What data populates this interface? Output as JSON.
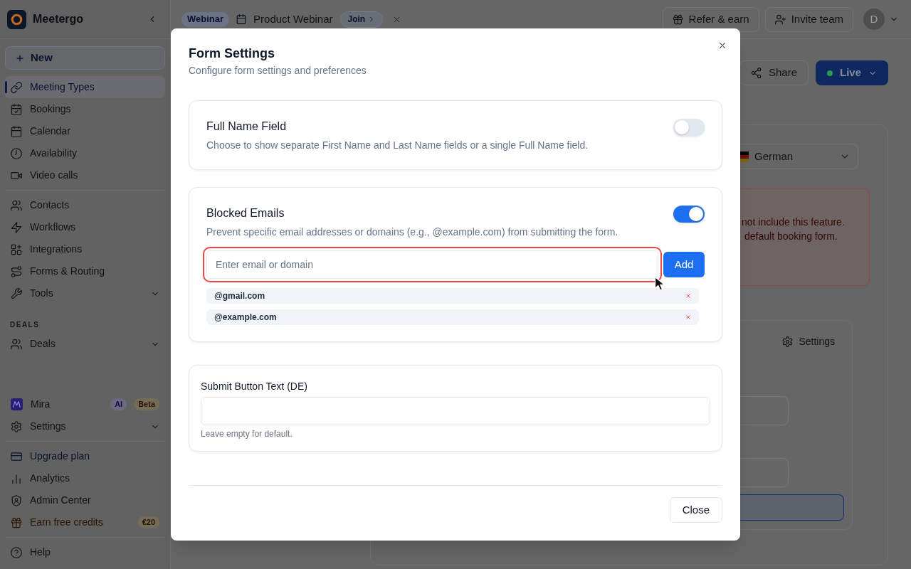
{
  "sidebar": {
    "brand": "Meetergo",
    "new_button": "New",
    "main_sections": [
      {
        "items": [
          {
            "label": "Meeting Types",
            "kind": "link",
            "selected": true
          },
          {
            "label": "Bookings",
            "kind": "link",
            "selected": false
          },
          {
            "label": "Calendar",
            "kind": "link",
            "selected": false
          },
          {
            "label": "Availability",
            "kind": "link",
            "selected": false
          },
          {
            "label": "Video calls",
            "kind": "link",
            "selected": false
          }
        ]
      },
      {
        "items": [
          {
            "label": "Contacts",
            "kind": "link",
            "selected": false
          },
          {
            "label": "Workflows",
            "kind": "link",
            "selected": false
          },
          {
            "label": "Integrations",
            "kind": "link",
            "selected": false
          },
          {
            "label": "Forms & Routing",
            "kind": "link",
            "selected": false
          },
          {
            "label": "Tools",
            "kind": "group",
            "selected": false
          }
        ]
      },
      {
        "heading": "DEALS",
        "items": [
          {
            "label": "Deals",
            "kind": "group",
            "selected": false
          }
        ]
      }
    ],
    "footer_sections": [
      {
        "items": [
          {
            "label": "Mira",
            "kind": "link",
            "selected": false,
            "badges": [
              {
                "text": "AI",
                "kind": "ai"
              },
              {
                "text": "Beta",
                "kind": "beta"
              }
            ]
          },
          {
            "label": "Settings",
            "kind": "group",
            "selected": false
          }
        ]
      },
      {
        "items": [
          {
            "label": "Upgrade plan",
            "kind": "promo",
            "selected": false
          },
          {
            "label": "Analytics",
            "kind": "link",
            "selected": false
          },
          {
            "label": "Admin Center",
            "kind": "link",
            "selected": false
          },
          {
            "label": "Earn free credits",
            "kind": "reward",
            "selected": false,
            "badges": [
              {
                "text": "€20",
                "kind": "reward"
              }
            ]
          }
        ]
      },
      {
        "items": [
          {
            "label": "Help",
            "kind": "link",
            "selected": false
          }
        ]
      }
    ]
  },
  "topbar": {
    "tag": "Webinar",
    "title": "Product Webinar",
    "join_button": "Join",
    "actions": [
      "Refer & earn",
      "Invite team"
    ],
    "avatar": "D"
  },
  "page": {
    "actions": [
      {
        "label": "Share",
        "kind": "outline"
      },
      {
        "label": "Live",
        "kind": "primary"
      }
    ],
    "language": "German",
    "notice_lines": [
      "not include this feature.",
      "default booking form."
    ],
    "settings_link": "Settings"
  },
  "modal": {
    "title": "Form Settings",
    "subtitle": "Configure form settings and preferences",
    "sections": [
      {
        "kind": "toggle",
        "title": "Full Name Field",
        "description": "Choose to show separate First Name and Last Name fields or a single Full Name field.",
        "on": false
      },
      {
        "kind": "blocklist",
        "title": "Blocked Emails",
        "description": "Prevent specific email addresses or domains (e.g., @example.com) from submitting the form.",
        "on": true,
        "input": {
          "placeholder": "Enter email or domain",
          "focused": true
        },
        "add_button": "Add",
        "entries": [
          "@gmail.com",
          "@example.com"
        ]
      },
      {
        "kind": "text",
        "label": "Submit Button Text (DE)",
        "hint": "Leave empty for default."
      }
    ],
    "footer_button": "Close"
  }
}
